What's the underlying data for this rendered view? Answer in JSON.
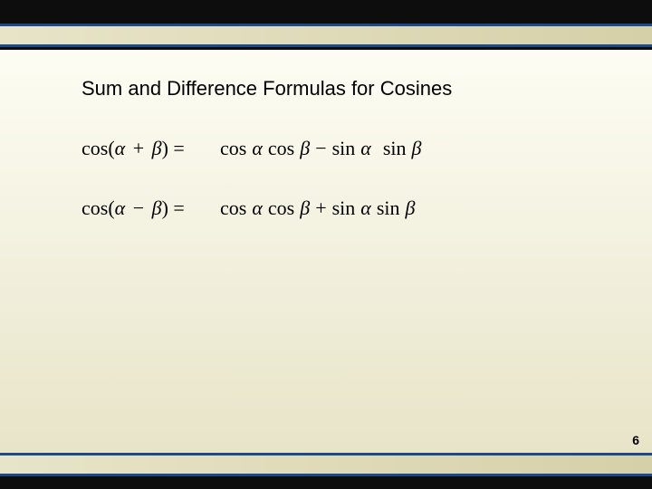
{
  "title": "Sum and Difference Formulas for Cosines",
  "alpha": "α",
  "beta": "β",
  "formulas": [
    {
      "lhs_fn": "cos(",
      "lhs_op": "+",
      "lhs_close": ") =",
      "t1": "cos",
      "t2": "cos",
      "mid_op": "−",
      "t3": "sin",
      "t4": "sin"
    },
    {
      "lhs_fn": "cos(",
      "lhs_op": "−",
      "lhs_close": ") =",
      "t1": "cos",
      "t2": "cos",
      "mid_op": "+",
      "t3": "sin",
      "t4": "sin"
    }
  ],
  "page_number": "6"
}
